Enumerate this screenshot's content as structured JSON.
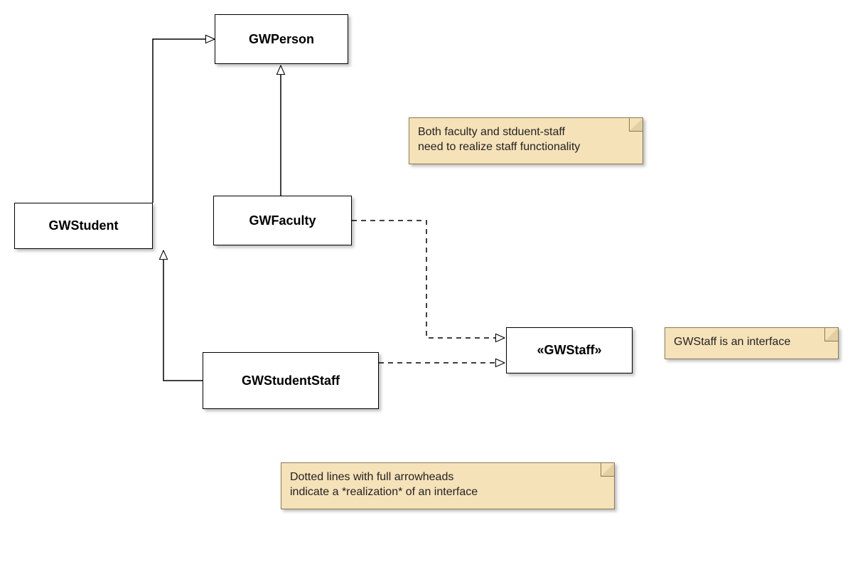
{
  "classes": {
    "person": {
      "label": "GWPerson"
    },
    "student": {
      "label": "GWStudent"
    },
    "faculty": {
      "label": "GWFaculty"
    },
    "studentstaff": {
      "label": "GWStudentStaff"
    },
    "staff": {
      "label": "«GWStaff»"
    }
  },
  "notes": {
    "note1_line1": "Both faculty and stduent-staff",
    "note1_line2": "need to realize staff functionality",
    "note2": "GWStaff is an interface",
    "note3_line1": "Dotted lines with full arrowheads",
    "note3_line2": "indicate a *realization* of an interface"
  },
  "relations": [
    {
      "from": "GWStudent",
      "to": "GWPerson",
      "type": "generalization"
    },
    {
      "from": "GWFaculty",
      "to": "GWPerson",
      "type": "generalization"
    },
    {
      "from": "GWStudentStaff",
      "to": "GWStudent",
      "type": "generalization"
    },
    {
      "from": "GWFaculty",
      "to": "GWStaff",
      "type": "realization"
    },
    {
      "from": "GWStudentStaff",
      "to": "GWStaff",
      "type": "realization"
    }
  ]
}
